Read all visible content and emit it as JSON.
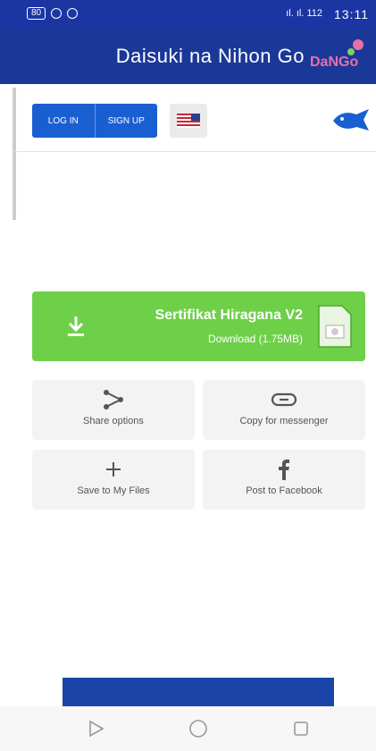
{
  "status_bar": {
    "time": "13:11",
    "signal_text": "ıl. ıl. 112",
    "battery": "80"
  },
  "app": {
    "title": "Daisuki na Nihon Go",
    "logo_text": "DaNGo"
  },
  "site_bar": {
    "login_label": "LOG IN",
    "signup_label": "SIGN UP",
    "flag_icon": "us-flag-icon"
  },
  "download": {
    "title": "Sertifikat Hiragana V2",
    "subtitle": "Download (1.75MB)",
    "accent": "#6ed048"
  },
  "actions": {
    "copy_messenger": "Copy for messenger",
    "share_options": "Share options",
    "post_facebook": "Post to Facebook",
    "save_files": "Save to My Files"
  },
  "colors": {
    "header": "#1a3898",
    "primary": "#1a5fd2"
  }
}
